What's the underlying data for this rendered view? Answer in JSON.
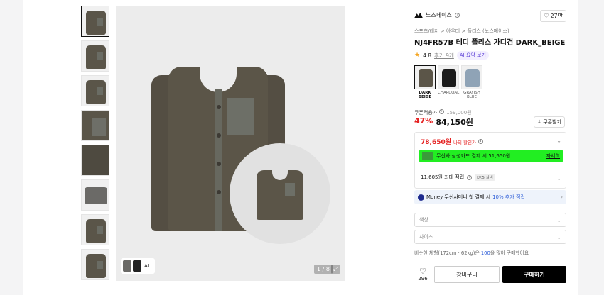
{
  "gallery": {
    "counter": "1 / 8",
    "mini_label": "AI",
    "expand_icon": "expand-icon"
  },
  "brand": {
    "name": "노스페이스",
    "likes": "27만"
  },
  "breadcrumb": "스포츠/레저 > 아우터 > 플리스 (노스페이스)",
  "product": {
    "title": "NJ4FR57B 테디 플리스 가디건 DARK_BEIGE",
    "rating": "4.8",
    "reviews": "후기 9개",
    "ai_summary": "AI 요약 보기"
  },
  "colors": [
    {
      "name": "DARK BEIGE",
      "hex": "#5b5548"
    },
    {
      "name": "CHARCOAL",
      "hex": "#1c1c1c"
    },
    {
      "name": "GRAYISH BLUE",
      "hex": "#8fa3b6"
    }
  ],
  "price": {
    "label": "쿠폰적용가",
    "original": "159,000원",
    "discount": "47%",
    "final": "84,150원",
    "coupon_button": "쿠폰받기"
  },
  "benefits": {
    "my_price": "78,650원",
    "my_price_label": "나의 할인가",
    "card_promo": "무신사 삼성카드 결제 시 51,650원",
    "card_more": "자세히",
    "points": "11,605원 최대 적립",
    "level": "LV.5 실버"
  },
  "money": {
    "text": "Money 무신사머니 첫 결제 시 ",
    "highlight": "10% 추가 적립"
  },
  "selects": {
    "color": "색상",
    "size": "사이즈"
  },
  "note": {
    "prefix": "비슷한 체형(172cm · 62kg)은 ",
    "highlight": "100",
    "suffix": "을 많이 구매했어요"
  },
  "actions": {
    "wish_count": "296",
    "cart": "장바구니",
    "buy": "구매하기"
  },
  "theme": {
    "accent_red": "#e52222",
    "promo_green": "#22ee22",
    "link_blue": "#2a5bd7"
  }
}
